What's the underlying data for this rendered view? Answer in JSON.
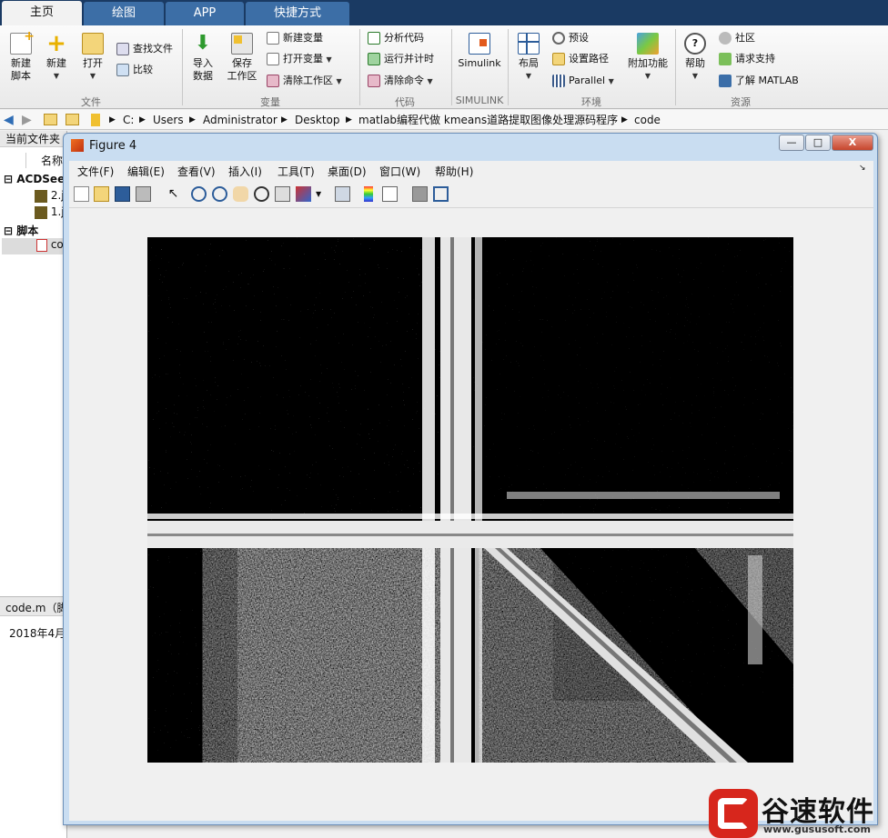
{
  "ribbon_tabs": [
    "主页",
    "绘图",
    "APP",
    "快捷方式"
  ],
  "ribbon": {
    "new_script": "新建\n脚本",
    "new": "新建",
    "open": "打开",
    "find_files": "查找文件",
    "compare": "比较",
    "import_data": "导入\n数据",
    "save_workspace": "保存\n工作区",
    "new_variable": "新建变量",
    "open_variable": "打开变量",
    "clear_workspace": "清除工作区",
    "analyze_code": "分析代码",
    "run_timed": "运行并计时",
    "clear_commands": "清除命令",
    "simulink": "Simulink",
    "layout": "布局",
    "preferences": "预设",
    "set_path": "设置路径",
    "parallel": "Parallel",
    "addons": "附加功能",
    "help": "帮助",
    "community": "社区",
    "request_support": "请求支持",
    "learn_matlab": "了解 MATLAB",
    "groups": [
      "文件",
      "变量",
      "代码",
      "SIMULINK",
      "环境",
      "资源"
    ]
  },
  "address": {
    "path": [
      "C:",
      "Users",
      "Administrator",
      "Desktop",
      "matlab编程代做 kmeans道路提取图像处理源码程序",
      "code"
    ]
  },
  "left_panel": {
    "title": "当前文件夹",
    "col_name": "名称",
    "group1": "ACDSee",
    "file1": "2.j",
    "file2": "1.j",
    "group2": "脚本",
    "file3": "co",
    "detail_title": "code.m（脚",
    "detail_date": "2018年4月"
  },
  "figure": {
    "title": "Figure 4",
    "menu": [
      "文件(F)",
      "编辑(E)",
      "查看(V)",
      "插入(I)",
      "工具(T)",
      "桌面(D)",
      "窗口(W)",
      "帮助(H)"
    ],
    "btn_min": "—",
    "btn_max": "□",
    "btn_close": "X"
  },
  "watermark": {
    "brand": "谷速软件",
    "url": "www.gususoft.com"
  }
}
